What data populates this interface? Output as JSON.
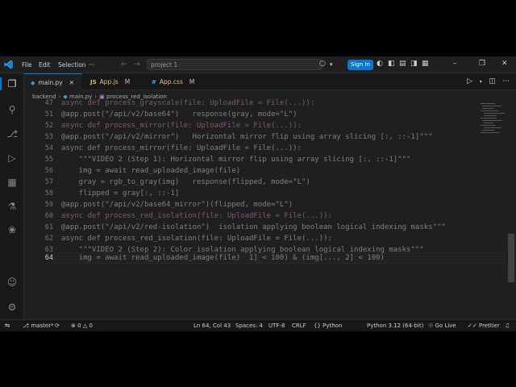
{
  "app": {
    "accent": "#0078d4",
    "background": "#1f1f1f"
  },
  "titlebar": {
    "menus": [
      "File",
      "Edit",
      "Selection"
    ],
    "more_icon": "ellipsis-icon",
    "search_placeholder": "project 1",
    "signin_label": "Sign In"
  },
  "tabs": [
    {
      "label": "main.py",
      "icon": "python-file-icon",
      "modified": "",
      "active": true
    },
    {
      "label": "App.js",
      "icon": "js-file-icon",
      "modified": "M",
      "active": false
    },
    {
      "label": "App.css",
      "icon": "css-file-icon",
      "modified": "M",
      "active": false
    }
  ],
  "breadcrumb": [
    "backend",
    "main.py",
    "process_red_isolation"
  ],
  "editor": {
    "line_numbers": [
      "47",
      "51",
      "52",
      "53",
      "54",
      "55",
      "56",
      "57",
      "58",
      "59",
      "60",
      "61",
      "62",
      "63",
      "64"
    ],
    "lines": [
      "async def process_grayscale(file: UploadFile = File(...)):",
      "@app.post(\"/api/v2/base64\")   response(gray, mode=\"L\")",
      "async def process_mirror(file: UploadFile = File(...)):",
      "@app.post(\"/api/v2/mirror\")   Horizontal mirror flip using array slicing [:, ::-1]\"\"\"",
      "async def process_mirror(file: UploadFile = File(...)):",
      "    \"\"\"VIDEO 2 (Step 1): Horizontal mirror flip using array slicing [:, ::-1]\"\"\"",
      "    img = await read_uploaded_image(file)",
      "    gray = rgb_to_gray(img)   response(flipped, mode=\"L\")",
      "    flipped = gray[:, ::-1]",
      "@app.post(\"/api/v2/base64_mirror\")(flipped, mode=\"L\")",
      "async def process_red_isolation(file: UploadFile = File(...)):",
      "@app.post(\"/api/v2/red-isolation\")  isolation applying boolean logical indexing masks\"\"\"",
      "async def process_red_isolation(file: UploadFile = File(...)):",
      "    \"\"\"VIDEO 2 (Step 2): Color isolation applying boolean logical indexing masks\"\"\"",
      "    img = await read_uploaded_image(file)  1] < 100) & (img[..., 2] < 100)"
    ]
  },
  "statusbar": {
    "branch": "master*",
    "errors": "0",
    "warnings": "0",
    "cursor": "Ln 64, Col 43",
    "spaces": "Spaces: 4",
    "encoding": "UTF-8",
    "eol": "CRLF",
    "language": "Python",
    "interpreter": "Python 3.12 (64-bit)",
    "golive": "Go Live",
    "prettier": "Prettier"
  }
}
